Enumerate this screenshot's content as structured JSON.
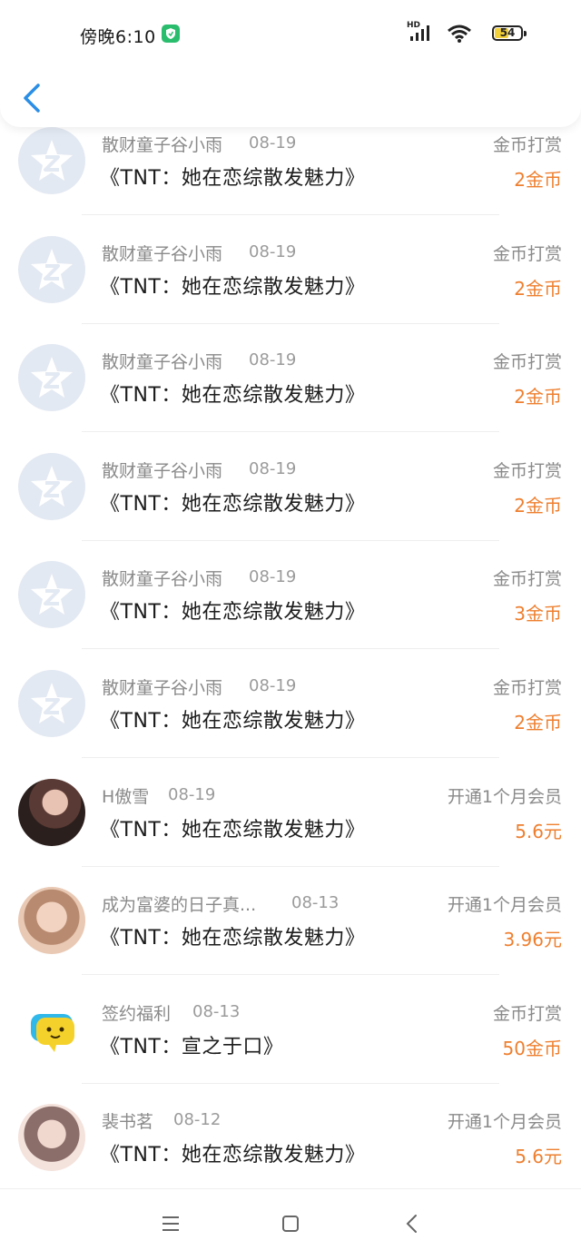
{
  "status_bar": {
    "time": "傍晚6:10",
    "network": "HD",
    "battery": "54",
    "battery_level": 0.54
  },
  "header": {
    "back_icon": "chevron-left-icon"
  },
  "records": [
    {
      "sender": "散财童子谷小雨",
      "date": "08-19",
      "book": "《TNT：她在恋综散发魅力》",
      "type": "金币打赏",
      "amount": "2金币",
      "avatar": "default"
    },
    {
      "sender": "散财童子谷小雨",
      "date": "08-19",
      "book": "《TNT：她在恋综散发魅力》",
      "type": "金币打赏",
      "amount": "2金币",
      "avatar": "default"
    },
    {
      "sender": "散财童子谷小雨",
      "date": "08-19",
      "book": "《TNT：她在恋综散发魅力》",
      "type": "金币打赏",
      "amount": "2金币",
      "avatar": "default"
    },
    {
      "sender": "散财童子谷小雨",
      "date": "08-19",
      "book": "《TNT：她在恋综散发魅力》",
      "type": "金币打赏",
      "amount": "2金币",
      "avatar": "default"
    },
    {
      "sender": "散财童子谷小雨",
      "date": "08-19",
      "book": "《TNT：她在恋综散发魅力》",
      "type": "金币打赏",
      "amount": "3金币",
      "avatar": "default"
    },
    {
      "sender": "散财童子谷小雨",
      "date": "08-19",
      "book": "《TNT：她在恋综散发魅力》",
      "type": "金币打赏",
      "amount": "2金币",
      "avatar": "default"
    },
    {
      "sender": "H傲雪",
      "date": "08-19",
      "book": "《TNT：她在恋综散发魅力》",
      "type": "开通1个月会员",
      "amount": "5.6元",
      "avatar": "photo1"
    },
    {
      "sender": "成为富婆的日子真...",
      "date": "08-13",
      "book": "《TNT：她在恋综散发魅力》",
      "type": "开通1个月会员",
      "amount": "3.96元",
      "avatar": "photo2"
    },
    {
      "sender": "签约福利",
      "date": "08-13",
      "book": "《TNT：宣之于口》",
      "type": "金币打赏",
      "amount": "50金币",
      "avatar": "emoji"
    },
    {
      "sender": "裴书茗",
      "date": "08-12",
      "book": "《TNT：她在恋综散发魅力》",
      "type": "开通1个月会员",
      "amount": "5.6元",
      "avatar": "photo3"
    }
  ],
  "nav": {
    "menu_icon": "menu-icon",
    "home_icon": "home-square-icon",
    "back_icon": "back-triangle-icon"
  }
}
